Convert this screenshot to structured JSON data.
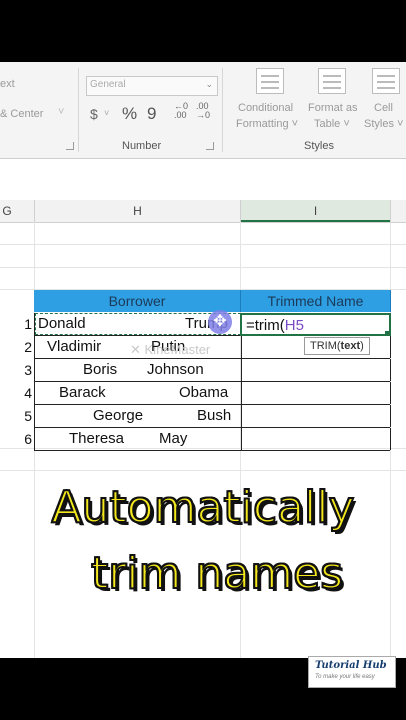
{
  "ribbon": {
    "left_fragment_top": "ext",
    "left_fragment_bottom": "& Center",
    "number_format_value": "General",
    "number_group_label": "Number",
    "styles_group_label": "Styles",
    "currency_symbol": "$",
    "percent_symbol": "%",
    "comma_symbol": "9",
    "inc_decimal": ".00\n→0",
    "dec_decimal": ".00\n→.0",
    "conditional_formatting_line1": "Conditional",
    "conditional_formatting_line2": "Formatting ˅",
    "format_as_table_line1": "Format as",
    "format_as_table_line2": "Table ˅",
    "cell_styles_line1": "Cell",
    "cell_styles_line2": "Styles ˅"
  },
  "columns": {
    "left_partial": "G",
    "h": "H",
    "i": "I"
  },
  "table": {
    "header_borrower": "Borrower",
    "header_trimmed": "Trimmed Name",
    "rows": [
      {
        "num": "1",
        "first": "Donald",
        "last": "Trump",
        "formula": "=trim(H5"
      },
      {
        "num": "2",
        "first": "Vladimir",
        "last": "Putin"
      },
      {
        "num": "3",
        "first": "Boris",
        "last": "Johnson"
      },
      {
        "num": "4",
        "first": "Barack",
        "last": "Obama"
      },
      {
        "num": "5",
        "first": "George",
        "last": "Bush"
      },
      {
        "num": "6",
        "first": "Theresa",
        "last": "May"
      }
    ],
    "formula_prefix": "=trim(",
    "formula_ref": "H5",
    "tooltip_fn": "TRIM(",
    "tooltip_arg": "text",
    "tooltip_close": ")"
  },
  "watermark": "✕ KineMaster",
  "caption": {
    "line1": "Automatically",
    "line2": "trim names"
  },
  "logo": {
    "title": "Tutorial Hub",
    "tagline": "To make your life easy"
  },
  "colors": {
    "header_fill": "#2f9fe3",
    "accent_green": "#217346",
    "caption_yellow": "#f4e81c"
  }
}
